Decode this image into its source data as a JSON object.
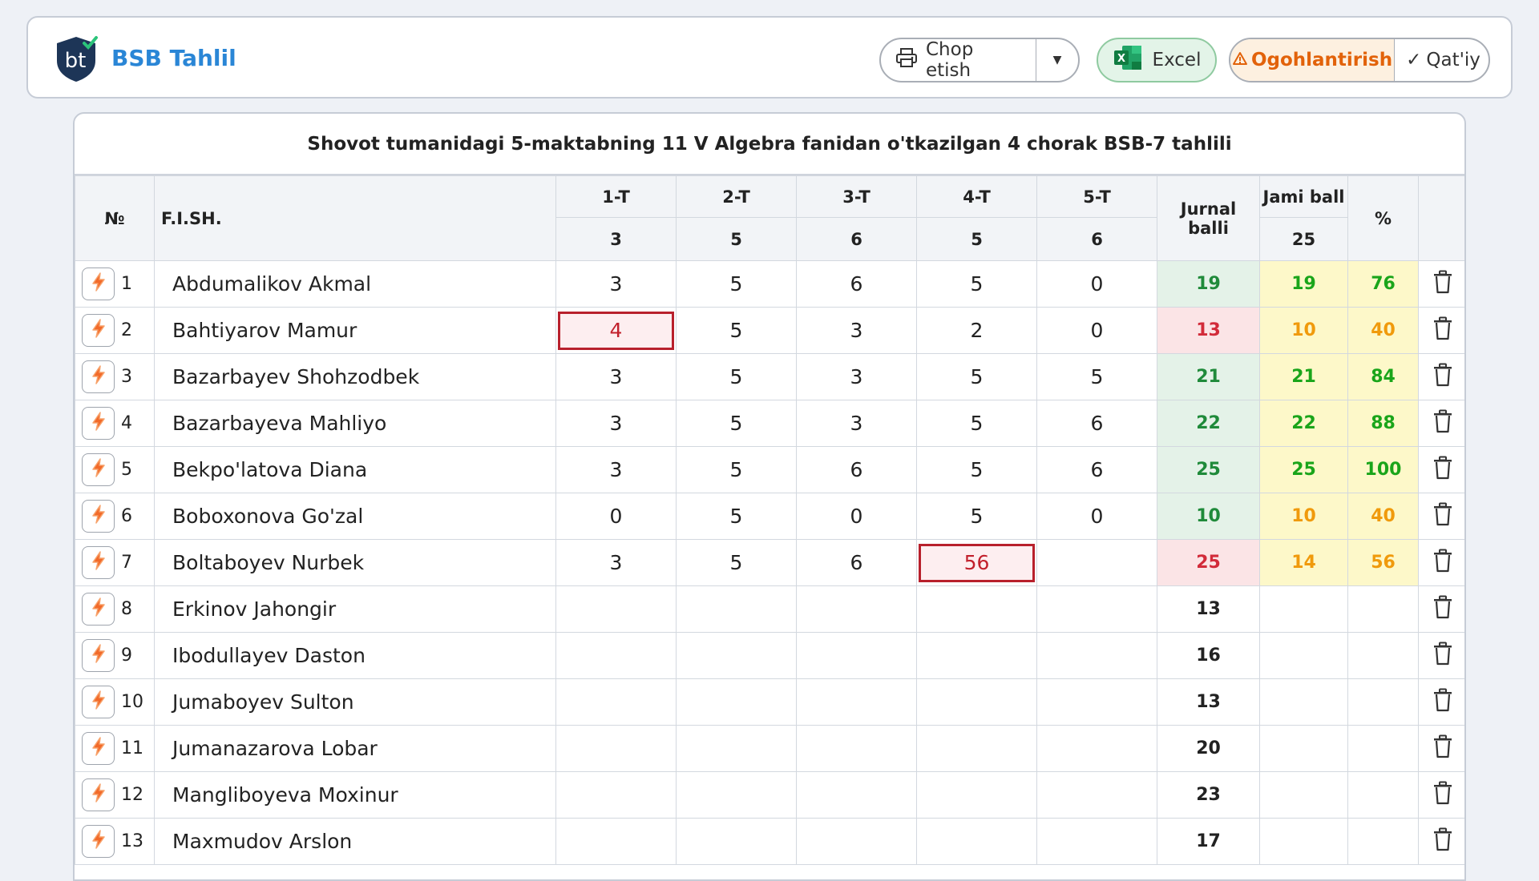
{
  "app": {
    "brand": "BSB Tahlil",
    "logo_text": "bt"
  },
  "toolbar": {
    "print_label": "Chop etish",
    "excel_label": "Excel",
    "warning_label": "Ogohlantirish",
    "final_label": "Qat'iy"
  },
  "table": {
    "title": "Shovot tumanidagi 5-maktabning 11 V Algebra fanidan o'tkazilgan 4 chorak BSB-7 tahlili",
    "headers": {
      "num": "№",
      "name": "F.I.SH.",
      "tasks": [
        "1-T",
        "2-T",
        "3-T",
        "4-T",
        "5-T"
      ],
      "task_max": [
        "3",
        "5",
        "6",
        "5",
        "6"
      ],
      "journal": "Jurnal balli",
      "total": "Jami ball",
      "total_max": "25",
      "percent": "%"
    },
    "rows": [
      {
        "n": "1",
        "name": "Abdumalikov Akmal",
        "scores": [
          "3",
          "5",
          "6",
          "5",
          "0"
        ],
        "journal": "19",
        "total": "19",
        "percent": "76"
      },
      {
        "n": "2",
        "name": "Bahtiyarov Mamur",
        "scores": [
          "4",
          "5",
          "3",
          "2",
          "0"
        ],
        "journal": "13",
        "total": "10",
        "percent": "40"
      },
      {
        "n": "3",
        "name": "Bazarbayev Shohzodbek",
        "scores": [
          "3",
          "5",
          "3",
          "5",
          "5"
        ],
        "journal": "21",
        "total": "21",
        "percent": "84"
      },
      {
        "n": "4",
        "name": "Bazarbayeva Mahliyo",
        "scores": [
          "3",
          "5",
          "3",
          "5",
          "6"
        ],
        "journal": "22",
        "total": "22",
        "percent": "88"
      },
      {
        "n": "5",
        "name": "Bekpo'latova Diana",
        "scores": [
          "3",
          "5",
          "6",
          "5",
          "6"
        ],
        "journal": "25",
        "total": "25",
        "percent": "100"
      },
      {
        "n": "6",
        "name": "Boboxonova Go'zal",
        "scores": [
          "0",
          "5",
          "0",
          "5",
          "0"
        ],
        "journal": "10",
        "total": "10",
        "percent": "40"
      },
      {
        "n": "7",
        "name": "Boltaboyev Nurbek",
        "scores": [
          "3",
          "5",
          "6",
          "56",
          ""
        ],
        "journal": "25",
        "total": "14",
        "percent": "56"
      },
      {
        "n": "8",
        "name": "Erkinov Jahongir",
        "scores": [
          "",
          "",
          "",
          "",
          ""
        ],
        "journal": "13",
        "total": "",
        "percent": ""
      },
      {
        "n": "9",
        "name": "Ibodullayev Daston",
        "scores": [
          "",
          "",
          "",
          "",
          ""
        ],
        "journal": "16",
        "total": "",
        "percent": ""
      },
      {
        "n": "10",
        "name": "Jumaboyev Sulton",
        "scores": [
          "",
          "",
          "",
          "",
          ""
        ],
        "journal": "13",
        "total": "",
        "percent": ""
      },
      {
        "n": "11",
        "name": "Jumanazarova Lobar",
        "scores": [
          "",
          "",
          "",
          "",
          ""
        ],
        "journal": "20",
        "total": "",
        "percent": ""
      },
      {
        "n": "12",
        "name": "Mangliboyeva Moxinur",
        "scores": [
          "",
          "",
          "",
          "",
          ""
        ],
        "journal": "23",
        "total": "",
        "percent": ""
      },
      {
        "n": "13",
        "name": "Maxmudov Arslon",
        "scores": [
          "",
          "",
          "",
          "",
          ""
        ],
        "journal": "17",
        "total": "",
        "percent": ""
      }
    ],
    "row_styles": {
      "journal": [
        "green",
        "red",
        "green",
        "green",
        "green",
        "green",
        "red",
        "plain",
        "plain",
        "plain",
        "plain",
        "plain",
        "plain"
      ],
      "total": [
        "green",
        "orange",
        "green",
        "green",
        "green",
        "orange",
        "orange",
        "",
        "",
        "",
        "",
        "",
        ""
      ],
      "error_cells": [
        [
          1,
          0
        ],
        [
          6,
          3
        ]
      ]
    }
  },
  "colors": {
    "brand": "#2a86d6",
    "warning": "#e2620a",
    "journal_ok": "#1f8a3a",
    "journal_bad": "#d22b3a",
    "score_ok": "#1aa51a",
    "score_mid": "#f09a0c",
    "error_border": "#b8202c"
  },
  "icons": {
    "row_action": "lightning-icon",
    "delete": "trash-icon",
    "print": "printer-icon",
    "excel": "excel-icon",
    "warning": "warning-triangle-icon",
    "final": "check-icon"
  }
}
